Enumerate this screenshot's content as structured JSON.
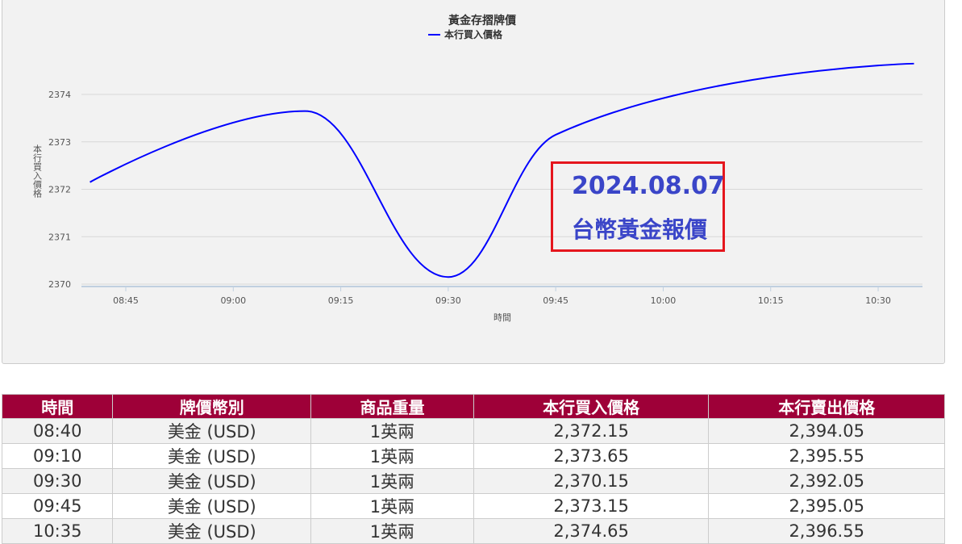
{
  "chart_data": {
    "type": "line",
    "title": "黃金存摺牌價",
    "legend": [
      "本行買入價格"
    ],
    "legend_position": "top-center",
    "xlabel": "時間",
    "ylabel": "本行買入價格",
    "x_ticks": [
      "08:45",
      "09:00",
      "09:15",
      "09:30",
      "09:45",
      "10:00",
      "10:15",
      "10:30"
    ],
    "y_ticks": [
      2370,
      2371,
      2372,
      2373,
      2374
    ],
    "ylim": [
      2370,
      2374
    ],
    "grid": true,
    "series": [
      {
        "name": "本行買入價格",
        "color": "#0000ff",
        "x": [
          "08:40",
          "09:10",
          "09:30",
          "09:45",
          "10:35"
        ],
        "values": [
          2372.15,
          2373.65,
          2370.15,
          2373.15,
          2374.65
        ]
      }
    ]
  },
  "annotation": {
    "date": "2024.08.07",
    "label": "台幣黃金報價"
  },
  "table": {
    "headers": [
      "時間",
      "牌價幣別",
      "商品重量",
      "本行買入價格",
      "本行賣出價格"
    ],
    "rows": [
      [
        "08:40",
        "美金 (USD)",
        "1英兩",
        "2,372.15",
        "2,394.05"
      ],
      [
        "09:10",
        "美金 (USD)",
        "1英兩",
        "2,373.65",
        "2,395.55"
      ],
      [
        "09:30",
        "美金 (USD)",
        "1英兩",
        "2,370.15",
        "2,392.05"
      ],
      [
        "09:45",
        "美金 (USD)",
        "1英兩",
        "2,373.15",
        "2,395.05"
      ],
      [
        "10:35",
        "美金 (USD)",
        "1英兩",
        "2,374.65",
        "2,396.55"
      ]
    ]
  }
}
